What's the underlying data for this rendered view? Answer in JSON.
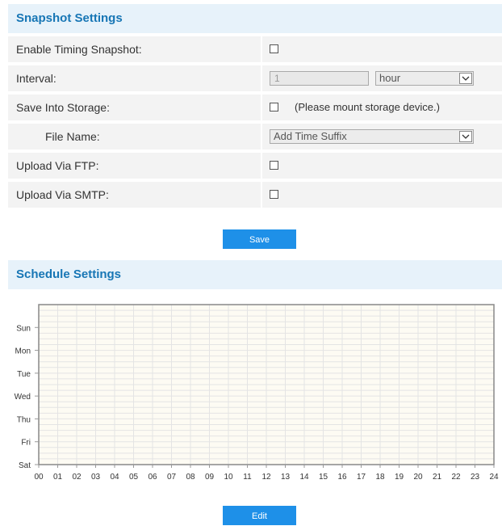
{
  "snapshot": {
    "title": "Snapshot Settings",
    "rows": {
      "enable_timing": {
        "label": "Enable Timing Snapshot:",
        "checked": false
      },
      "interval": {
        "label": "Interval:",
        "value": "1",
        "unit": "hour"
      },
      "save_storage": {
        "label": "Save Into Storage:",
        "checked": false,
        "note": "(Please mount storage device.)"
      },
      "file_name": {
        "label": "File Name:",
        "value": "Add Time Suffix"
      },
      "upload_ftp": {
        "label": "Upload Via FTP:",
        "checked": false
      },
      "upload_smtp": {
        "label": "Upload Via SMTP:",
        "checked": false
      }
    },
    "save_label": "Save"
  },
  "schedule": {
    "title": "Schedule Settings",
    "days": [
      "Sun",
      "Mon",
      "Tue",
      "Wed",
      "Thu",
      "Fri",
      "Sat"
    ],
    "hours": [
      "00",
      "01",
      "02",
      "03",
      "04",
      "05",
      "06",
      "07",
      "08",
      "09",
      "10",
      "11",
      "12",
      "13",
      "14",
      "15",
      "16",
      "17",
      "18",
      "19",
      "20",
      "21",
      "22",
      "23",
      "24"
    ],
    "edit_label": "Edit",
    "colors": {
      "grid_bg": "#fdfbf3",
      "grid_line": "#e4e4e4",
      "border": "#888888"
    }
  },
  "colors": {
    "accent": "#1776b5",
    "header_bg": "#e7f2fa",
    "row_bg": "#f3f3f3",
    "button": "#1e90e8"
  }
}
